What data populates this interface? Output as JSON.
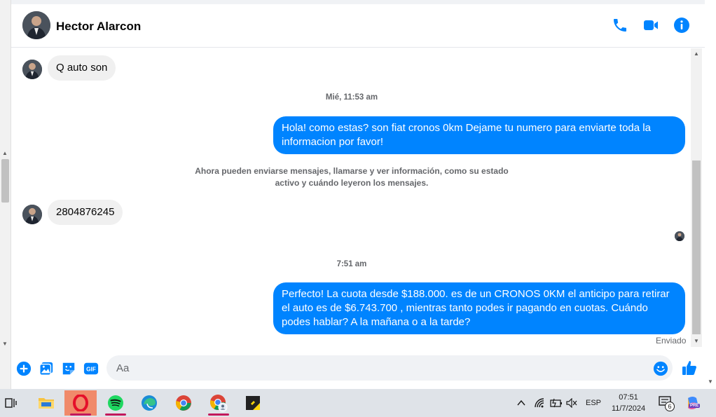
{
  "header": {
    "contact_name": "Hector Alarcon"
  },
  "messages": [
    {
      "type": "in",
      "text": "Q auto son"
    },
    {
      "type": "timestamp",
      "text": "Mié, 11:53 am"
    },
    {
      "type": "out",
      "text": "Hola! como estas? son fiat cronos 0km Dejame tu numero para enviarte toda la informacion por favor!"
    },
    {
      "type": "system",
      "line1": "Ahora pueden enviarse mensajes, llamarse y ver información, como su estado",
      "line2": "activo y cuándo leyeron los mensajes."
    },
    {
      "type": "in",
      "text": "2804876245"
    },
    {
      "type": "timestamp",
      "text": "7:51 am"
    },
    {
      "type": "out",
      "text": "Perfecto! La cuota desde $188.000. es de un CRONOS 0KM el anticipo para retirar el auto es de $6.743.700 , mientras tanto podes ir pagando en cuotas. Cuándo podes hablar? A la mañana o a la tarde?"
    }
  ],
  "status": {
    "sent_label": "Enviado"
  },
  "composer": {
    "placeholder": "Aa",
    "gif_label": "GIF"
  },
  "colors": {
    "accent": "#0084ff",
    "incoming_bubble": "#f0f0f0",
    "secondary_text": "#65676b"
  },
  "taskbar": {
    "apps": [
      "task-view-icon",
      "file-explorer-icon",
      "opera-icon",
      "spotify-icon",
      "edge-icon",
      "chrome-icon",
      "chrome-profile-icon",
      "sticky-notes-icon"
    ],
    "language": "ESP",
    "time": "07:51",
    "date": "11/7/2024",
    "notifications_count": "6",
    "copilot_badge": "PRE"
  }
}
